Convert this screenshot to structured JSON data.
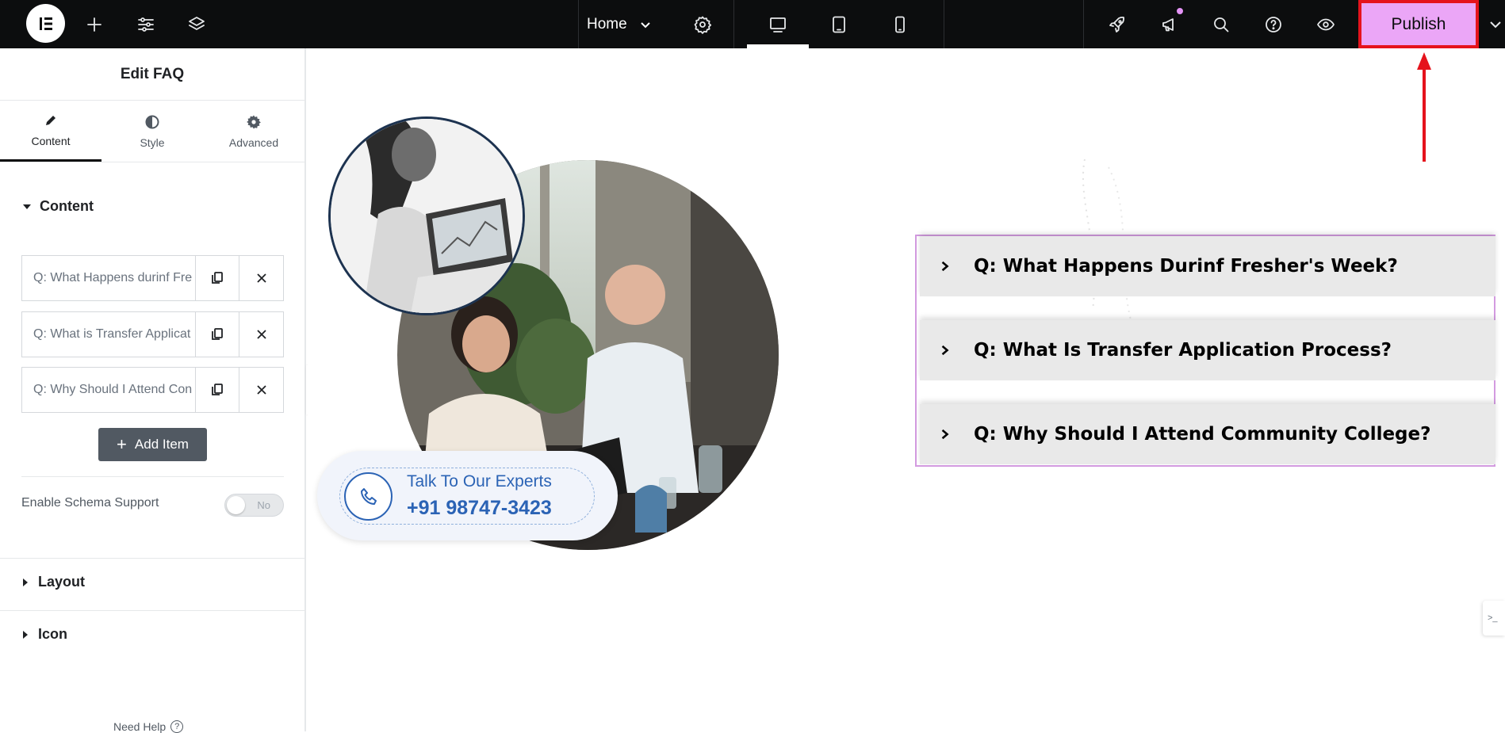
{
  "topbar": {
    "page_name": "Home",
    "publish_label": "Publish"
  },
  "panel": {
    "title": "Edit FAQ",
    "tabs": [
      {
        "label": "Content"
      },
      {
        "label": "Style"
      },
      {
        "label": "Advanced"
      }
    ],
    "content_section": "Content",
    "items": [
      {
        "title": "Q: What Happens durinf Fre"
      },
      {
        "title": "Q: What is Transfer Applicat"
      },
      {
        "title": "Q: Why Should I Attend Con"
      }
    ],
    "add_item_label": "Add Item",
    "schema_label": "Enable Schema Support",
    "schema_value": "No",
    "layout_section": "Layout",
    "icon_section": "Icon",
    "need_help": "Need Help"
  },
  "canvas": {
    "cta_line1": "Talk To Our Experts",
    "cta_line2": "+91 98747-3423",
    "faq": [
      {
        "question": "Q: What Happens Durinf Fresher's Week?"
      },
      {
        "question": "Q: What Is Transfer Application Process?"
      },
      {
        "question": "Q: Why Should I Attend Community College?"
      }
    ],
    "side_chip": ">_"
  },
  "colors": {
    "publish_bg": "#eba6f7",
    "highlight_red": "#e5131c",
    "cta_blue": "#2b63b5",
    "faq_border": "#d39be0"
  }
}
